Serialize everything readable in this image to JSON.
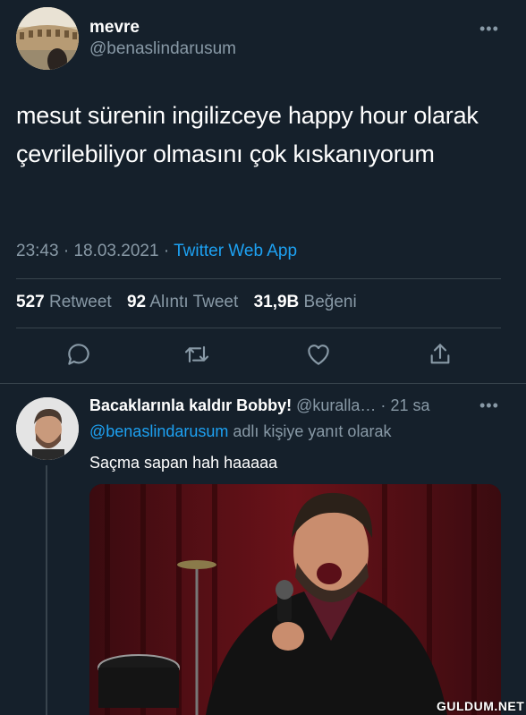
{
  "tweet": {
    "display_name": "mevre",
    "handle": "@benaslindarusum",
    "more": "•••",
    "text": "mesut sürenin ingilizceye happy hour olarak çevrilebiliyor olmasını çok kıskanıyorum",
    "time": "23:43",
    "date": "18.03.2021",
    "dot": "·",
    "source": "Twitter Web App",
    "stats": {
      "retweets": "527",
      "retweets_label": "Retweet",
      "quotes": "92",
      "quotes_label": "Alıntı Tweet",
      "likes": "31,9B",
      "likes_label": "Beğeni"
    },
    "actions": [
      "reply-icon",
      "retweet-icon",
      "like-icon",
      "share-icon"
    ]
  },
  "reply": {
    "display_name": "Bacaklarınla kaldır Bobby!",
    "handle": "@kuralla…",
    "dot": "·",
    "age": "21 sa",
    "more": "•••",
    "reply_to_handle": "@benaslindarusum",
    "reply_to_suffix": "adlı kişiye yanıt olarak",
    "text": "Saçma sapan hah haaaaa"
  },
  "watermark": "GULDUM.NET",
  "colors": {
    "background": "#15202b",
    "muted": "#8899a6",
    "link": "#1da1f2",
    "divider": "#38444d"
  }
}
